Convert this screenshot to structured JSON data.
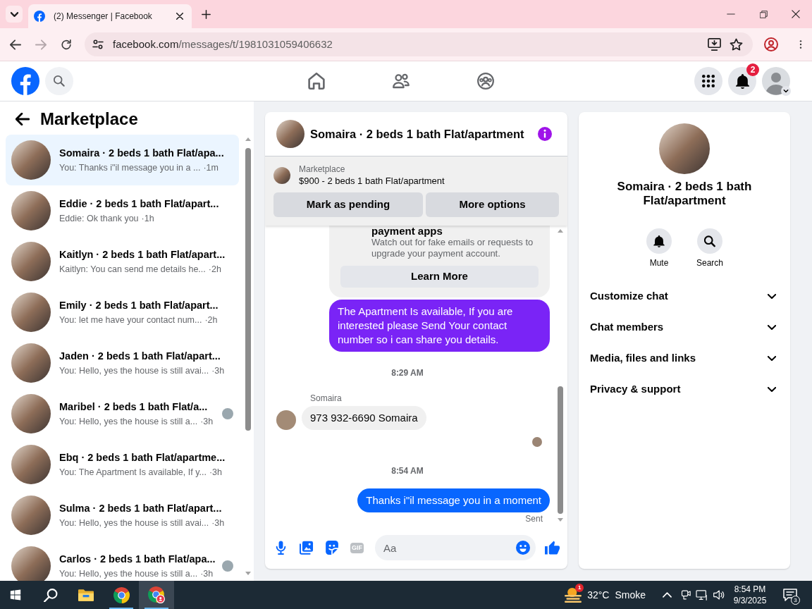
{
  "browser": {
    "tab": {
      "title": "(2) Messenger | Facebook"
    },
    "nav_buttons": [
      {
        "kind": "back",
        "disabled": false
      },
      {
        "kind": "forward",
        "disabled": true
      },
      {
        "kind": "reload",
        "disabled": false
      }
    ],
    "address": {
      "url": "facebook.com/messages/t/1981031059406632"
    }
  },
  "header": {
    "nav": [
      {
        "kind": "home",
        "selected": false
      },
      {
        "kind": "friends",
        "selected": false
      },
      {
        "kind": "groups",
        "selected": false
      }
    ],
    "notifications_badge": "2"
  },
  "sidebar": {
    "title": "Marketplace",
    "conversations": [
      {
        "title": "Somaira · 2 beds 1 bath Flat/apa...",
        "preview": "You: Thanks i\"il message you in a ...",
        "time": "·1m",
        "selected": true,
        "seen": false
      },
      {
        "title": "Eddie · 2 beds 1 bath Flat/apart...",
        "preview": "Eddie: Ok thank you",
        "time": "·1h",
        "selected": false,
        "seen": false
      },
      {
        "title": "Kaitlyn · 2 beds 1 bath Flat/apart...",
        "preview": "Kaitlyn: You can send me details he...",
        "time": "·2h",
        "selected": false,
        "seen": false
      },
      {
        "title": "Emily · 2 beds 1 bath Flat/apart...",
        "preview": "You: let me have your contact num...",
        "time": "·2h",
        "selected": false,
        "seen": false
      },
      {
        "title": "Jaden · 2 beds 1 bath Flat/apart...",
        "preview": "You: Hello, yes the house is still avai...",
        "time": "·3h",
        "selected": false,
        "seen": false
      },
      {
        "title": "Maribel · 2 beds 1 bath Flat/a...",
        "preview": "You: Hello, yes the house is still a...",
        "time": "·3h",
        "selected": false,
        "seen": true
      },
      {
        "title": "Ebq · 2 beds 1 bath Flat/apartme...",
        "preview": "You: The Apartment Is available, If y...",
        "time": "·3h",
        "selected": false,
        "seen": false
      },
      {
        "title": "Sulma · 2 beds 1 bath Flat/apart...",
        "preview": "You: Hello, yes the house is still avai...",
        "time": "·3h",
        "selected": false,
        "seen": false
      },
      {
        "title": "Carlos · 2 beds 1 bath Flat/apa...",
        "preview": "You: Hello, yes the house is still a...",
        "time": "·3h",
        "selected": false,
        "seen": true
      }
    ]
  },
  "chat": {
    "title": "Somaira · 2 beds 1 bath Flat/apartment",
    "listing": {
      "label": "Marketplace",
      "text": "$900 - 2 beds 1 bath Flat/apartment"
    },
    "actions": [
      "Mark as pending",
      "More options"
    ],
    "messages": [
      {
        "kind": "notice",
        "title": "payment apps",
        "text": "Watch out for fake emails or requests to upgrade your payment account.",
        "button": "Learn More"
      },
      {
        "kind": "outgoing",
        "text": "The Apartment Is available, If you are interested please Send Your contact number so i can share you details.",
        "color": "#7a24f6"
      },
      {
        "kind": "time",
        "text": "8:29 AM"
      },
      {
        "kind": "incoming",
        "sender": "Somaira",
        "text": "973 932-6690 Somaira"
      },
      {
        "kind": "seen"
      },
      {
        "kind": "time",
        "text": "8:54 AM"
      },
      {
        "kind": "outgoing",
        "text": "Thanks i\"il message you in a moment",
        "color": "#0866ff",
        "status": "Sent"
      }
    ],
    "composer": {
      "gif_label": "GIF",
      "placeholder": "Aa"
    }
  },
  "details": {
    "title": "Somaira · 2 beds 1 bath Flat/apartment",
    "actions": [
      {
        "kind": "mute",
        "label": "Mute"
      },
      {
        "kind": "search",
        "label": "Search"
      }
    ],
    "sections": [
      {
        "label": "Customize chat",
        "expanded": false
      },
      {
        "label": "Chat members",
        "expanded": false
      },
      {
        "label": "Media, files and links",
        "expanded": false
      },
      {
        "label": "Privacy & support",
        "expanded": false
      }
    ]
  },
  "taskbar": {
    "apps": [
      {
        "kind": "start",
        "running": false,
        "selected": false
      },
      {
        "kind": "search",
        "running": false,
        "selected": false
      },
      {
        "kind": "explorer",
        "running": false,
        "selected": false
      },
      {
        "kind": "browser",
        "running": true,
        "selected": false
      },
      {
        "kind": "browser_profile",
        "running": true,
        "selected": true
      }
    ],
    "weather": {
      "badge": "1",
      "temperature": "32°C",
      "condition": "Smoke"
    },
    "clock": {
      "time": "8:54 PM",
      "date": "9/3/2025"
    },
    "notifications_badge": "3"
  }
}
